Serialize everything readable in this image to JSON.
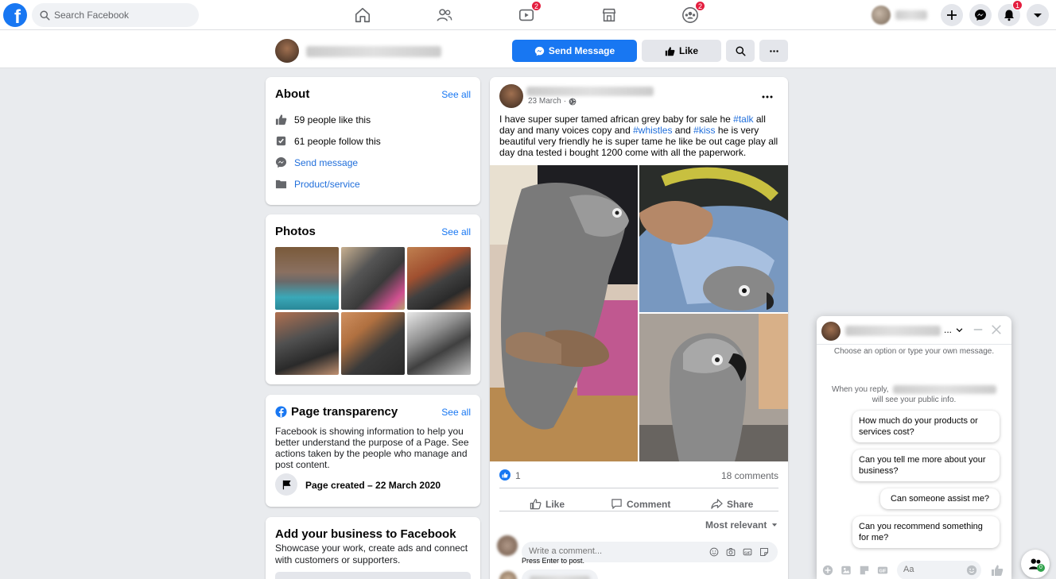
{
  "app": {
    "logo_letter": "f"
  },
  "search": {
    "placeholder": "Search Facebook"
  },
  "nav": {
    "watch_badge": "2",
    "groups_badge": "2"
  },
  "right": {
    "notifications_badge": "1"
  },
  "page_header": {
    "send_message_label": "Send Message",
    "like_label": "Like"
  },
  "about": {
    "title": "About",
    "see_all": "See all",
    "likes": "59 people like this",
    "follows": "61 people follow this",
    "send_message": "Send message",
    "category": "Product/service"
  },
  "photos": {
    "title": "Photos",
    "see_all": "See all"
  },
  "transparency": {
    "title": "Page transparency",
    "see_all": "See all",
    "text": "Facebook is showing information to help you better understand the purpose of a Page. See actions taken by the people who manage and post content.",
    "created": "Page created – 22 March 2020"
  },
  "add_business": {
    "title": "Add your business to Facebook",
    "text": "Showcase your work, create ads and connect with customers or supporters."
  },
  "post": {
    "date": "23 March",
    "text_1": "I have super super tamed african grey baby for sale he ",
    "tag_talk": "#talk",
    "text_2": " all day and many voices copy and ",
    "tag_whistles": "#whistles",
    "text_3": " and ",
    "tag_kiss": "#kiss",
    "text_4": " he is very beautiful very friendly he is super tame he like be out cage play all day dna tested i bought 1200 come with all the paperwork.",
    "reaction_count": "1",
    "comments_count": "18 comments",
    "like_label": "Like",
    "comment_label": "Comment",
    "share_label": "Share",
    "sort_label": "Most relevant",
    "comment_placeholder": "Write a comment...",
    "enter_hint": "Press Enter to post."
  },
  "chat": {
    "ellipsis": "...",
    "intro": "Choose an option or type your own message.",
    "reply_before": "When you reply,",
    "reply_after": "will see your public info.",
    "options": [
      "How much do your products or services cost?",
      "Can you tell me more about your business?",
      "Can someone assist me?",
      "Can you recommend something for me?"
    ],
    "input_placeholder": "Aa",
    "people_badge": "0"
  }
}
